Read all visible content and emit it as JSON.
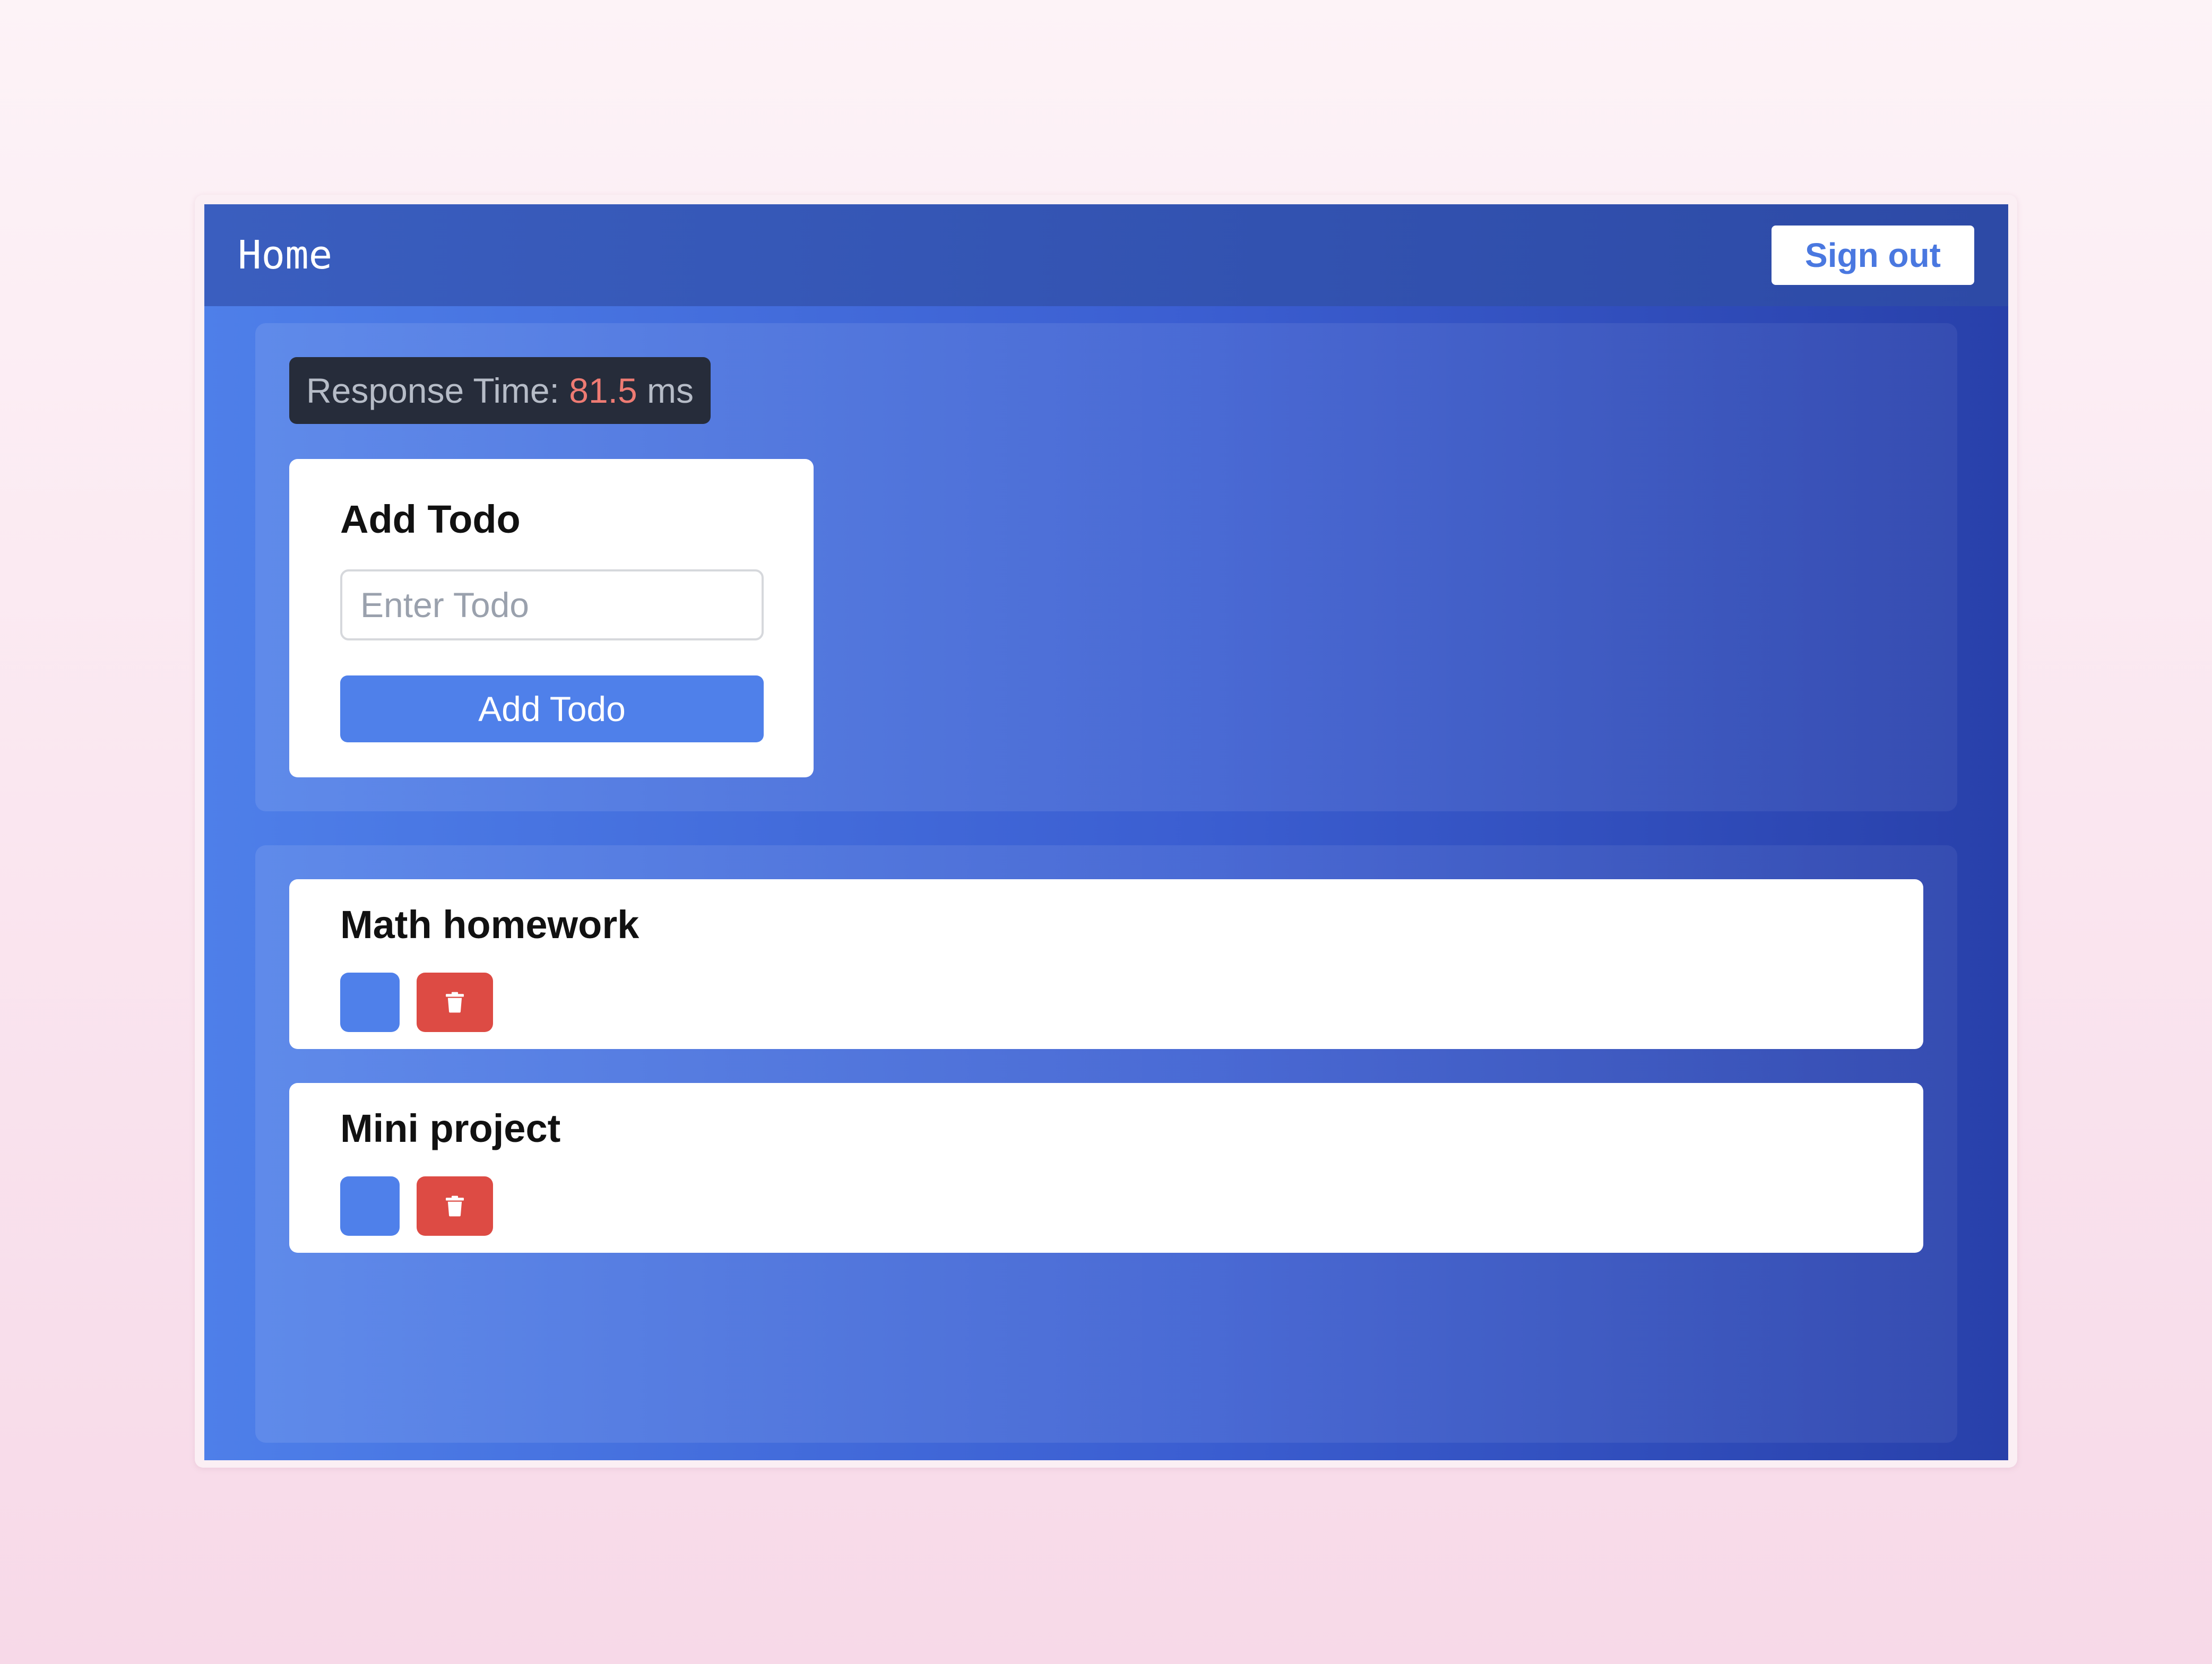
{
  "header": {
    "title": "Home",
    "signout_label": "Sign out"
  },
  "metrics": {
    "response_label": "Response Time:",
    "response_value": "81.5",
    "response_unit": "ms"
  },
  "add_form": {
    "title": "Add Todo",
    "input_placeholder": "Enter Todo",
    "input_value": "",
    "button_label": "Add Todo"
  },
  "todos": [
    {
      "title": "Math homework",
      "edit_icon": "blank-icon",
      "delete_icon": "trash-icon"
    },
    {
      "title": "Mini project",
      "edit_icon": "blank-icon",
      "delete_icon": "trash-icon"
    }
  ],
  "colors": {
    "accent": "#4f80ea",
    "danger": "#dd4b44",
    "response_value": "#ee7b73"
  }
}
